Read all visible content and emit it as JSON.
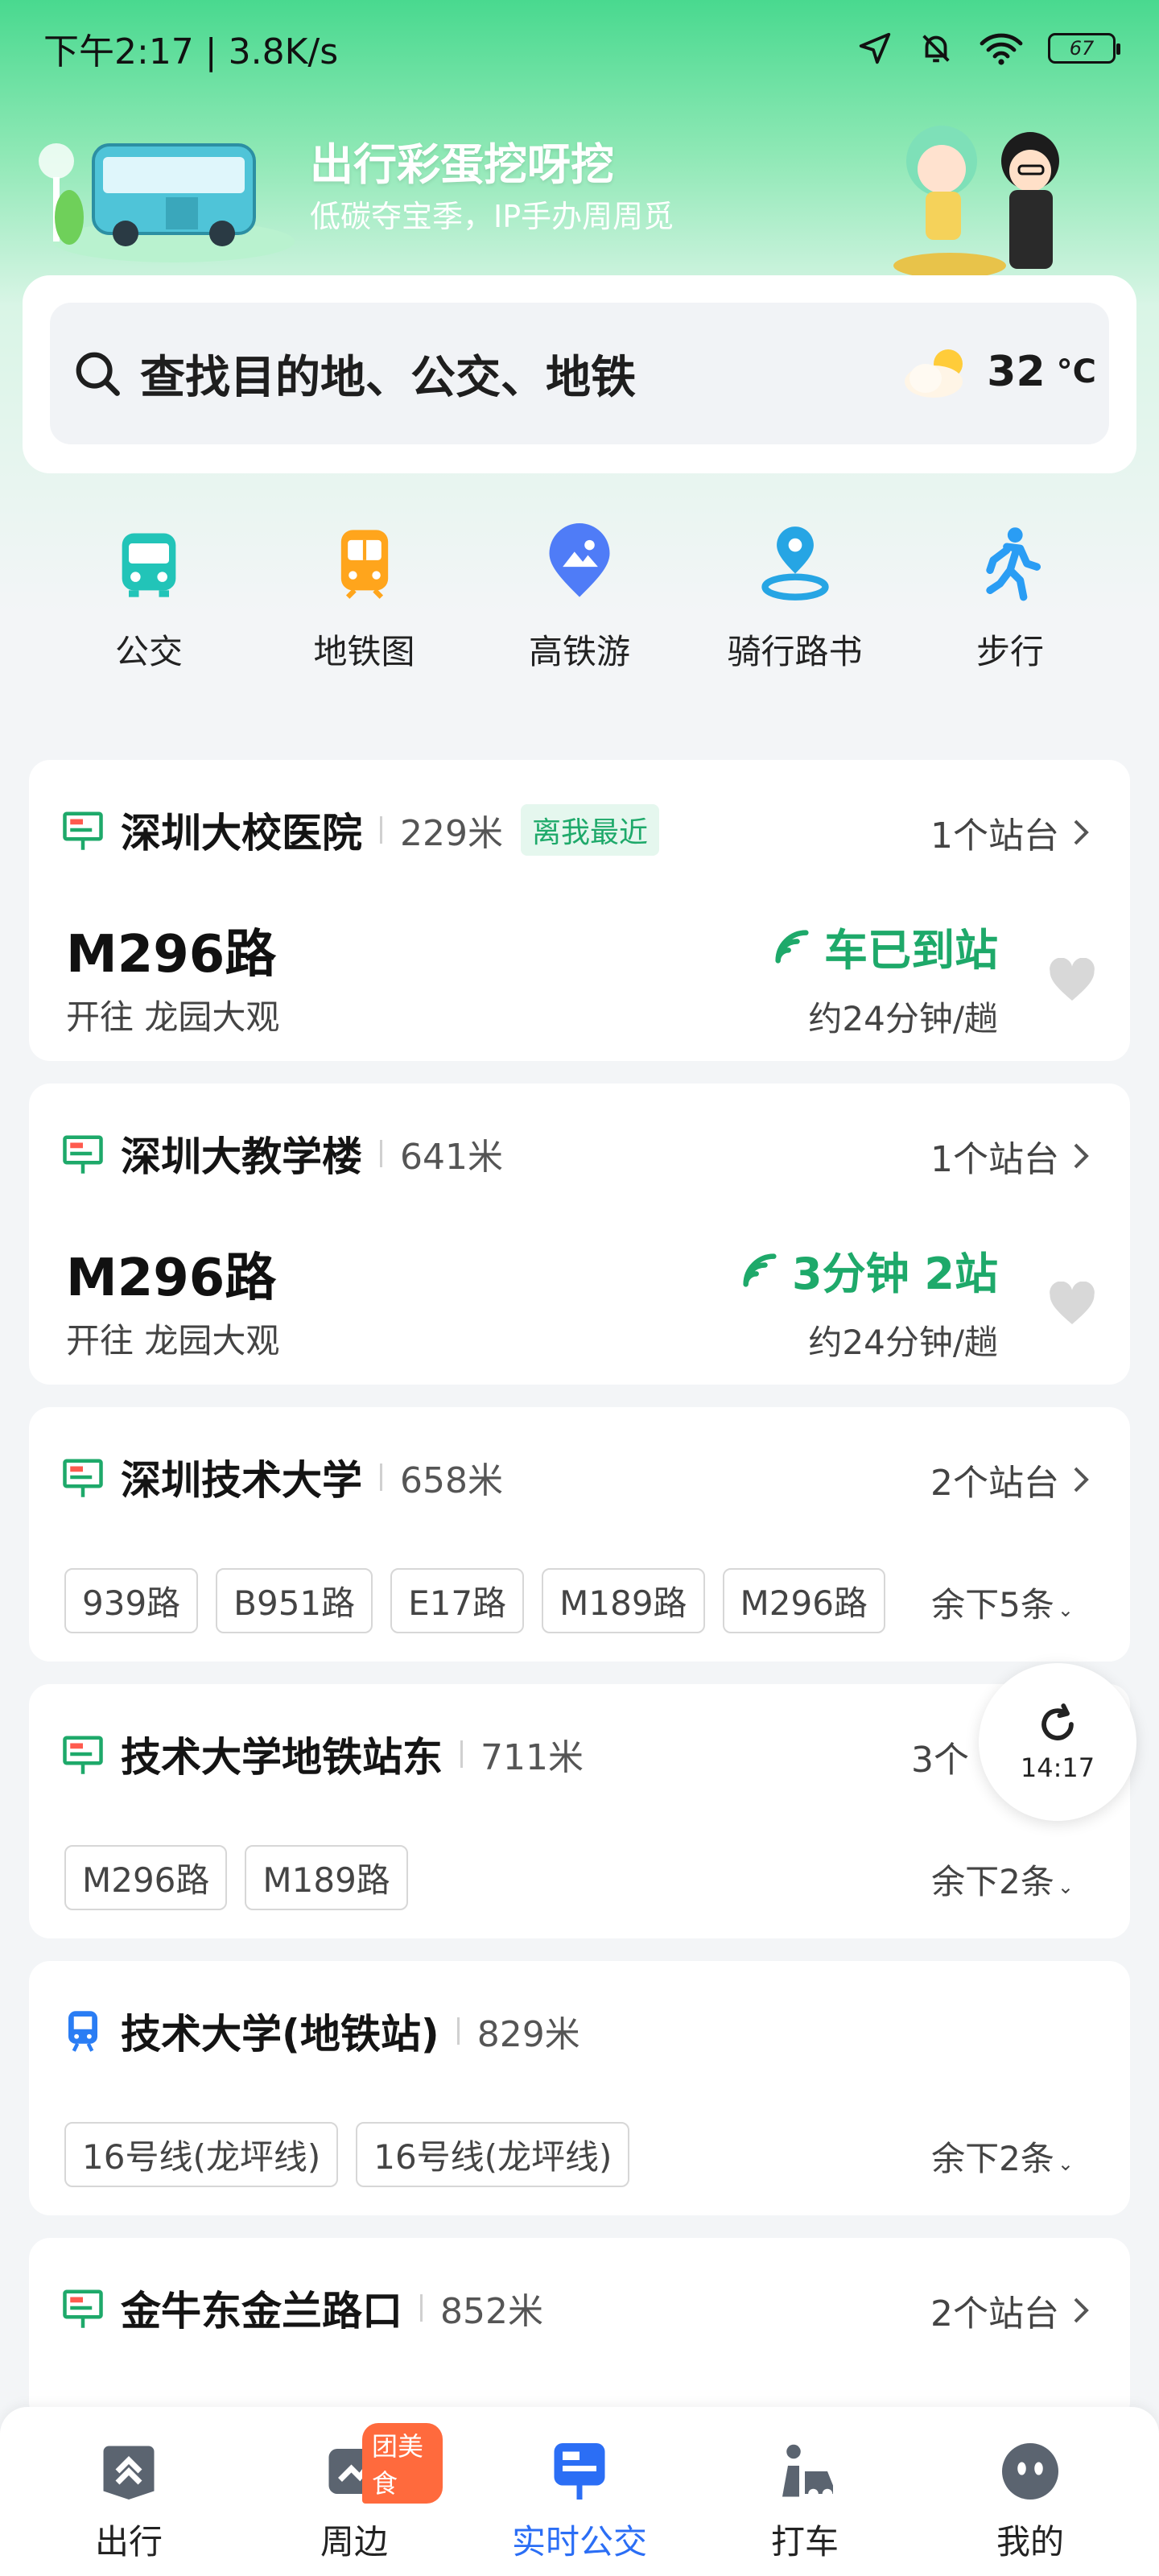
{
  "status_bar": {
    "time": "下午2:17 | 3.8K/s",
    "battery": "67"
  },
  "banner": {
    "title": "出行彩蛋挖呀挖",
    "subtitle": "低碳夺宝季，IP手办周周觅"
  },
  "search": {
    "placeholder": "查找目的地、公交、地铁",
    "temperature": "32",
    "temp_unit": "°C"
  },
  "quick_nav": [
    {
      "label": "公交",
      "icon": "bus-icon"
    },
    {
      "label": "地铁图",
      "icon": "subway-icon"
    },
    {
      "label": "高铁游",
      "icon": "hsr-tour-icon"
    },
    {
      "label": "骑行路书",
      "icon": "cycling-route-icon"
    },
    {
      "label": "步行",
      "icon": "walking-icon"
    }
  ],
  "stops": [
    {
      "name": "深圳大校医院",
      "distance": "229米",
      "badge": "离我最近",
      "platforms": "1个站台",
      "route": "M296路",
      "direction": "开往 龙园大观",
      "arrival": "车已到站",
      "frequency": "约24分钟/趟"
    },
    {
      "name": "深圳大教学楼",
      "distance": "641米",
      "platforms": "1个站台",
      "route": "M296路",
      "direction": "开往 龙园大观",
      "arrival": "3分钟 2站",
      "frequency": "约24分钟/趟"
    },
    {
      "name": "深圳技术大学",
      "distance": "658米",
      "platforms": "2个站台",
      "tags": [
        "939路",
        "B951路",
        "E17路",
        "M189路",
        "M296路"
      ],
      "remaining": "余下5条"
    },
    {
      "name": "技术大学地铁站东",
      "distance": "711米",
      "platforms": "3个",
      "tags": [
        "M296路",
        "M189路"
      ],
      "remaining": "余下2条"
    },
    {
      "name": "技术大学(地铁站)",
      "distance": "829米",
      "tags": [
        "16号线(龙坪线)",
        "16号线(龙坪线)"
      ],
      "remaining": "余下2条"
    },
    {
      "name": "金牛东金兰路口",
      "distance": "852米",
      "platforms": "2个站台"
    }
  ],
  "refresh": {
    "time": "14:17"
  },
  "tabbar": [
    {
      "label": "出行",
      "icon": "travel-icon"
    },
    {
      "label": "周边",
      "icon": "nearby-icon",
      "badge": "团美食"
    },
    {
      "label": "实时公交",
      "icon": "realtime-bus-icon"
    },
    {
      "label": "打车",
      "icon": "taxi-icon"
    },
    {
      "label": "我的",
      "icon": "profile-icon"
    }
  ],
  "colors": {
    "accent_green": "#1ea96a",
    "active_blue": "#2b6ef5",
    "banner_green": "#49d98f"
  }
}
